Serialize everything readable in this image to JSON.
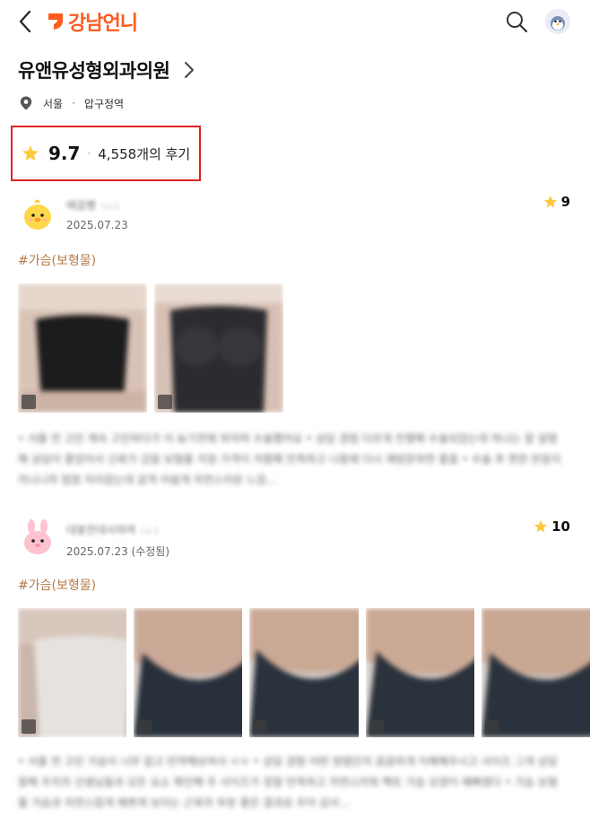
{
  "header": {
    "back_icon": "chevron-left-icon",
    "logo_text": "강남언니",
    "brand_color": "#ff5a1f",
    "search_icon": "search-icon",
    "profile_icon": "avatar-icon"
  },
  "clinic": {
    "name": "유앤유성형외과의원",
    "city": "서울",
    "area": "압구정역",
    "separator": "·"
  },
  "rating": {
    "score": "9.7",
    "separator": "·",
    "review_count": "4,558개의 후기",
    "star_color": "#ffc83d",
    "highlight_color": "#e12222"
  },
  "reviews": [
    {
      "author": "배꼽빵",
      "level": "Lv.1",
      "date": "2025.07.23",
      "score": "9",
      "tag": "#가슴(보형물)",
      "photo_count": 2,
      "text": "• 서울 전 고민 계속 고민하다가 이 늦기전에 하자며 수술했어요 • 상담 경험 다르게 진행해 수술되었는데 하나는 잘 설명해 상담이 좋았어서 신뢰가 갔음 보형물 걱정 가격이 저렴해 만족하고 나중에 다시 재방문하면 좋을 • 수술 후 편한 반응이 지나니까 점점 자리잡는데 감격 아쉽게 자연스러운 느낌..."
    },
    {
      "author": "대봉한데서하며",
      "level": "Lv.1",
      "date": "2025.07.23 (수정됨)",
      "score": "10",
      "tag": "#가슴(보형물)",
      "photo_count": 5,
      "text": "• 서울 전 고민 가슴이 너무 없고 빈약해보여서 ㅠㅠ • 상담 경험 어떤 방법인지 꼼꼼하게 이해해주시고 사이즈 그게 상담 잘해 주치의 선생님들과 모든 요소 확인해 주 사이즈가 정말 만족하고 자연스러워 팩트 가슴 모양이 예뻐졌다 • 가슴 보형물 가슴과 자연스럽게 예쁘게 보이는 근육의 부분 좋은 결과로 주어 감사..."
    }
  ]
}
